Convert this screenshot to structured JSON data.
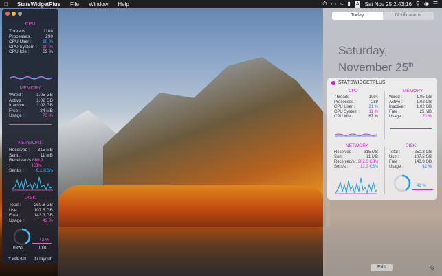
{
  "menubar": {
    "app_name": "StatsWidgetPlus",
    "menus": [
      "File",
      "Window",
      "Help"
    ],
    "datetime": "Sat Nov 25  2:43:16",
    "input_source": "A"
  },
  "left_panel": {
    "cpu": {
      "title": "CPU",
      "rows": [
        {
          "k": "Threads :",
          "v": "1108"
        },
        {
          "k": "Processes :",
          "v": "290"
        },
        {
          "k": "CPU User :",
          "v": "20 %"
        },
        {
          "k": "CPU System :",
          "v": "10 %"
        },
        {
          "k": "CPU Idle :",
          "v": "69 %"
        }
      ]
    },
    "memory": {
      "title": "MEMORY",
      "rows": [
        {
          "k": "Wired :",
          "v": "1.05 GB"
        },
        {
          "k": "Active :",
          "v": "1.02 GB"
        },
        {
          "k": "Inactive :",
          "v": "1.02 GB"
        },
        {
          "k": "Free :",
          "v": "24 MB"
        },
        {
          "k": "Usage :",
          "v": "73 %"
        }
      ]
    },
    "network": {
      "title": "NETWORK",
      "rows": [
        {
          "k": "Received :",
          "v": "315 MB"
        },
        {
          "k": "Sent :",
          "v": "11 MB"
        },
        {
          "k": "Received/s :",
          "v": "666.7 KB/s"
        },
        {
          "k": "Sent/s :",
          "v": "6.1 KB/s"
        }
      ]
    },
    "disk": {
      "title": "DISK",
      "rows": [
        {
          "k": "Total :",
          "v": "250.8 GB"
        },
        {
          "k": "Use :",
          "v": "107.5 GB"
        },
        {
          "k": "Free :",
          "v": "143.3 GB"
        },
        {
          "k": "Usage :",
          "v": "42 %"
        }
      ],
      "ring_label": "42 %",
      "usage_fraction": 0.42
    },
    "buttons": {
      "news": "news",
      "info": "info",
      "add_on": "+ add-on",
      "layout": "layout"
    }
  },
  "notification_center": {
    "tabs": {
      "today": "Today",
      "notifications": "Notifications"
    },
    "date_line1": "Saturday,",
    "date_line2": "November 25",
    "date_suffix": "th",
    "widget_name": "STATSWIDGETPLUS",
    "cpu": {
      "title": "CPU",
      "rows": [
        {
          "k": "Threads :",
          "v": "1094"
        },
        {
          "k": "Processes :",
          "v": "289"
        },
        {
          "k": "CPU User :",
          "v": "21 %"
        },
        {
          "k": "CPU System :",
          "v": "11 %"
        },
        {
          "k": "CPU Idle :",
          "v": "67 %"
        }
      ]
    },
    "memory": {
      "title": "MEMORY",
      "rows": [
        {
          "k": "Wired :",
          "v": "1.05 GB"
        },
        {
          "k": "Active :",
          "v": "1.02 GB"
        },
        {
          "k": "Inactive :",
          "v": "1.02 GB"
        },
        {
          "k": "Free :",
          "v": "25 MB"
        },
        {
          "k": "Usage :",
          "v": "73 %"
        }
      ]
    },
    "network": {
      "title": "NETWORK",
      "rows": [
        {
          "k": "Received :",
          "v": "315 MB"
        },
        {
          "k": "Sent :",
          "v": "11 MB"
        },
        {
          "k": "Received/s :",
          "v": "282.0 KB/s"
        },
        {
          "k": "Sent/s :",
          "v": "12.3 KB/s"
        }
      ]
    },
    "disk": {
      "title": "DISK",
      "rows": [
        {
          "k": "Total :",
          "v": "250.8 GB"
        },
        {
          "k": "Use :",
          "v": "107.5 GB"
        },
        {
          "k": "Free :",
          "v": "143.3 GB"
        },
        {
          "k": "Usage :",
          "v": "42 %"
        }
      ],
      "ring_label": "42 %",
      "usage_fraction": 0.42
    },
    "edit_label": "Edit"
  },
  "colors": {
    "accent_pink": "#e94fd4",
    "accent_blue": "#4db3ff",
    "ring_cyan": "#39c6ff"
  }
}
